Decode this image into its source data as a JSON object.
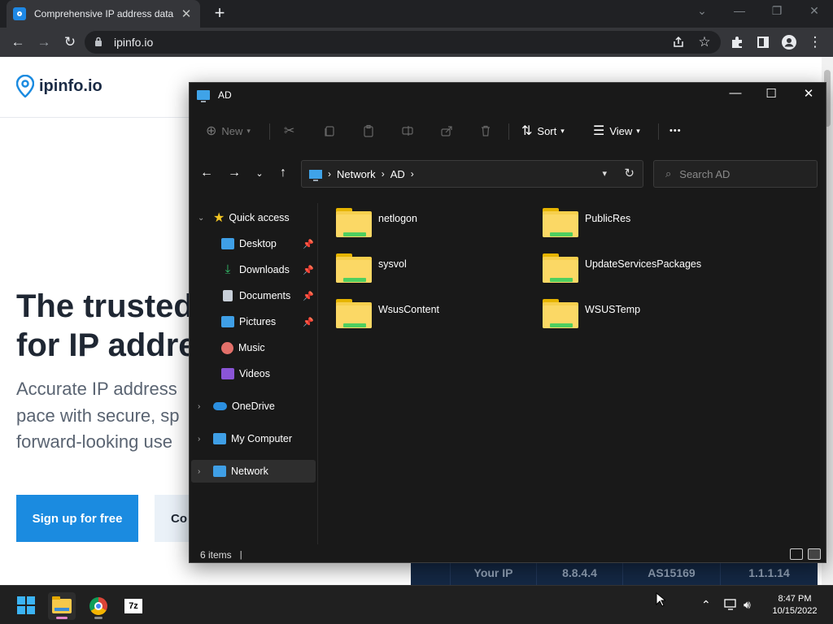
{
  "browser": {
    "tab_title": "Comprehensive IP address data, I",
    "tab_close_glyph": "✕",
    "new_tab_glyph": "+",
    "window_controls": {
      "dropdown": "⌄",
      "minimize": "—",
      "restore": "❐",
      "close": "✕"
    },
    "nav": {
      "back": "←",
      "forward": "→",
      "reload": "↻"
    },
    "url": "ipinfo.io",
    "toolbar_icons": [
      "share-icon",
      "star-icon",
      "extensions-icon",
      "side-panel-icon",
      "profile-icon",
      "menu-icon"
    ]
  },
  "page": {
    "logo_text": "ipinfo.io",
    "hero_line1": "The trusted",
    "hero_line2": "for IP addre",
    "sub_line1": "Accurate IP address",
    "sub_line2": "pace with secure, sp",
    "sub_line3": "forward-looking use",
    "cta_primary": "Sign up for free",
    "cta_secondary": "Co",
    "ip_bar": [
      "Your IP",
      "8.8.4.4",
      "AS15169",
      "1.1.1.14"
    ],
    "accent_color": "#1b8be0"
  },
  "explorer": {
    "title": "AD",
    "window_controls": {
      "minimize": "—",
      "maximize": "☐",
      "close": "✕"
    },
    "commands": {
      "new_label": "New",
      "sort_label": "Sort",
      "view_label": "View",
      "more_label": "•••"
    },
    "breadcrumb": [
      "Network",
      "AD"
    ],
    "search_placeholder": "Search AD",
    "sidebar": {
      "quick_access": "Quick access",
      "desktop": "Desktop",
      "downloads": "Downloads",
      "documents": "Documents",
      "pictures": "Pictures",
      "music": "Music",
      "videos": "Videos",
      "onedrive": "OneDrive",
      "my_computer": "My Computer",
      "network": "Network"
    },
    "folders": [
      "netlogon",
      "PublicRes",
      "sysvol",
      "UpdateServicesPackages",
      "WsusContent",
      "WSUSTemp"
    ],
    "status": "6 items"
  },
  "taskbar": {
    "time": "8:47 PM",
    "date": "10/15/2022",
    "apps": [
      "file-explorer",
      "chrome",
      "7-zip"
    ],
    "seven_zip_label": "7z"
  }
}
